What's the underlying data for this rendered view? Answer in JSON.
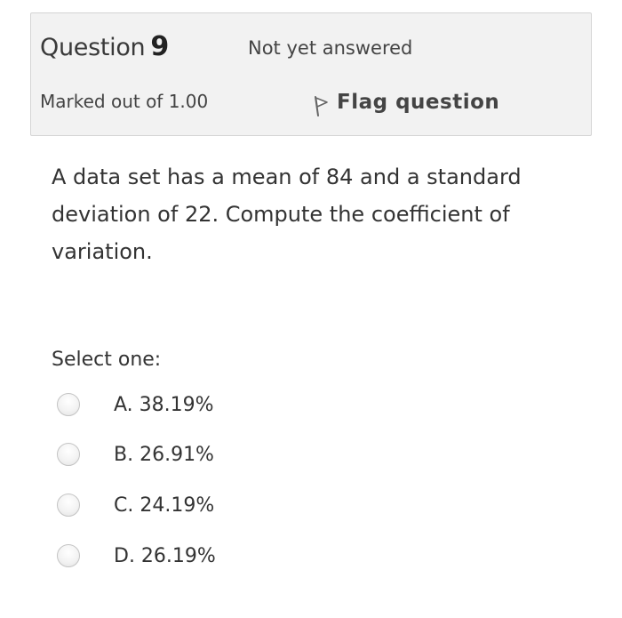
{
  "info": {
    "question_word": "Question",
    "question_number": "9",
    "state": "Not yet answered",
    "grade": "Marked out of 1.00",
    "flag_label": "Flag question"
  },
  "question": {
    "text": "A data set has a mean of 84 and a standard deviation of 22. Compute the coefficient of variation."
  },
  "answers": {
    "prompt": "Select one:",
    "options": [
      {
        "label": "A. 38.19%",
        "selected": false
      },
      {
        "label": "B. 26.91%",
        "selected": false
      },
      {
        "label": "C. 24.19%",
        "selected": false
      },
      {
        "label": "D. 26.19%",
        "selected": false
      }
    ]
  },
  "icons": {
    "flag": "flag-icon",
    "radio": "radio-icon"
  }
}
